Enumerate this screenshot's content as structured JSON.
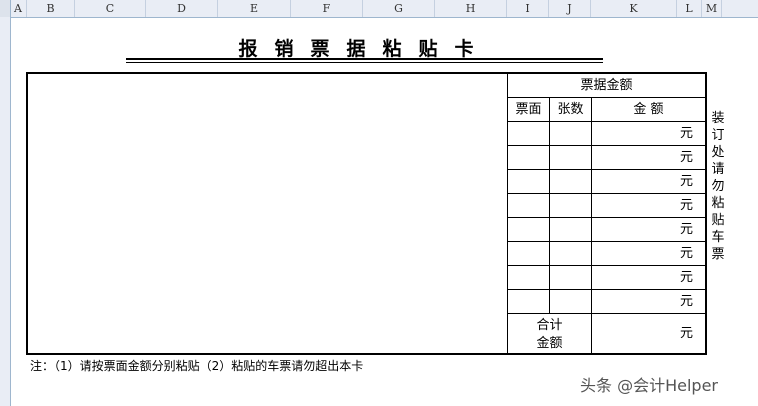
{
  "columns": [
    "A",
    "B",
    "C",
    "D",
    "E",
    "F",
    "G",
    "H",
    "I",
    "J",
    "K",
    "L",
    "M"
  ],
  "title": "报销票据粘贴卡",
  "table": {
    "header": "票据金额",
    "col_face": "票面",
    "col_count": "张数",
    "col_amount": "金 额",
    "rows": [
      "元",
      "元",
      "元",
      "元",
      "元",
      "元",
      "元",
      "元"
    ],
    "total_label_1": "合计",
    "total_label_2": "金额",
    "total_unit": "元"
  },
  "side_note": "装订处请勿粘贴车票",
  "footnote": "注：（1）请按票面金额分别粘贴（2）粘贴的车票请勿超出本卡",
  "watermark": "头条 @会计Helper"
}
